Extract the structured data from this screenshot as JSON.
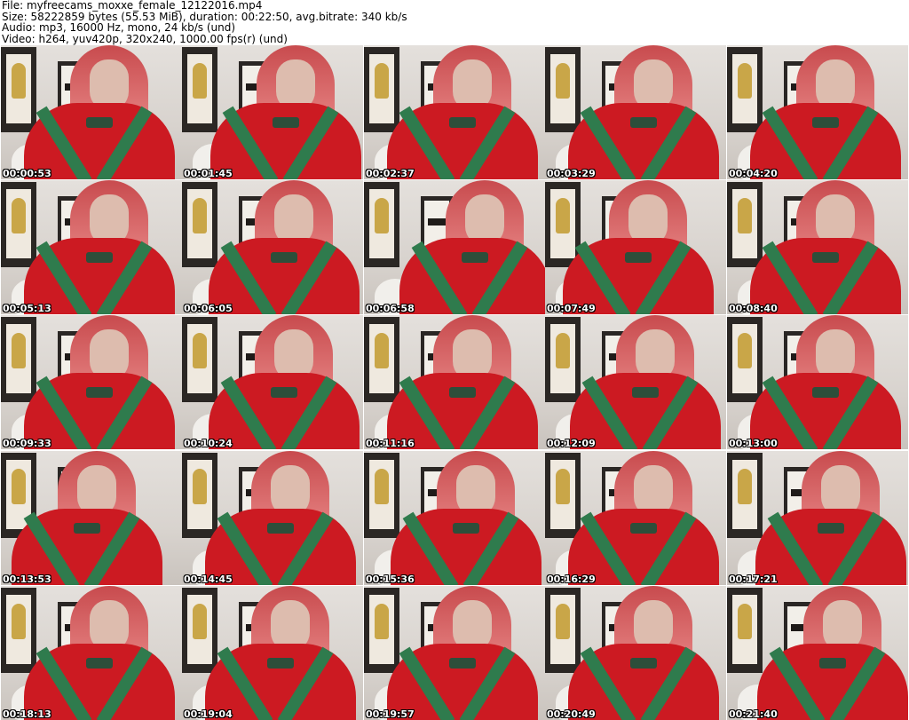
{
  "header": {
    "file_line": "File: myfreecams_moxxe_female_12122016.mp4",
    "size_line": "Size: 58222859 bytes (55.53 MiB), duration: 00:22:50, avg.bitrate: 340 kb/s",
    "audio_line": "Audio: mp3, 16000 Hz, mono, 24 kb/s (und)",
    "video_line": "Video: h264, yuv420p, 320x240, 1000.00 fps(r) (und)"
  },
  "thumbnails": [
    "00:00:53",
    "00:01:45",
    "00:02:37",
    "00:03:29",
    "00:04:20",
    "00:05:13",
    "00:06:05",
    "00:06:58",
    "00:07:49",
    "00:08:40",
    "00:09:33",
    "00:10:24",
    "00:11:16",
    "00:12:09",
    "00:13:00",
    "00:13:53",
    "00:14:45",
    "00:15:36",
    "00:16:29",
    "00:17:21",
    "00:18:13",
    "00:19:04",
    "00:19:57",
    "00:20:49",
    "00:21:40"
  ]
}
